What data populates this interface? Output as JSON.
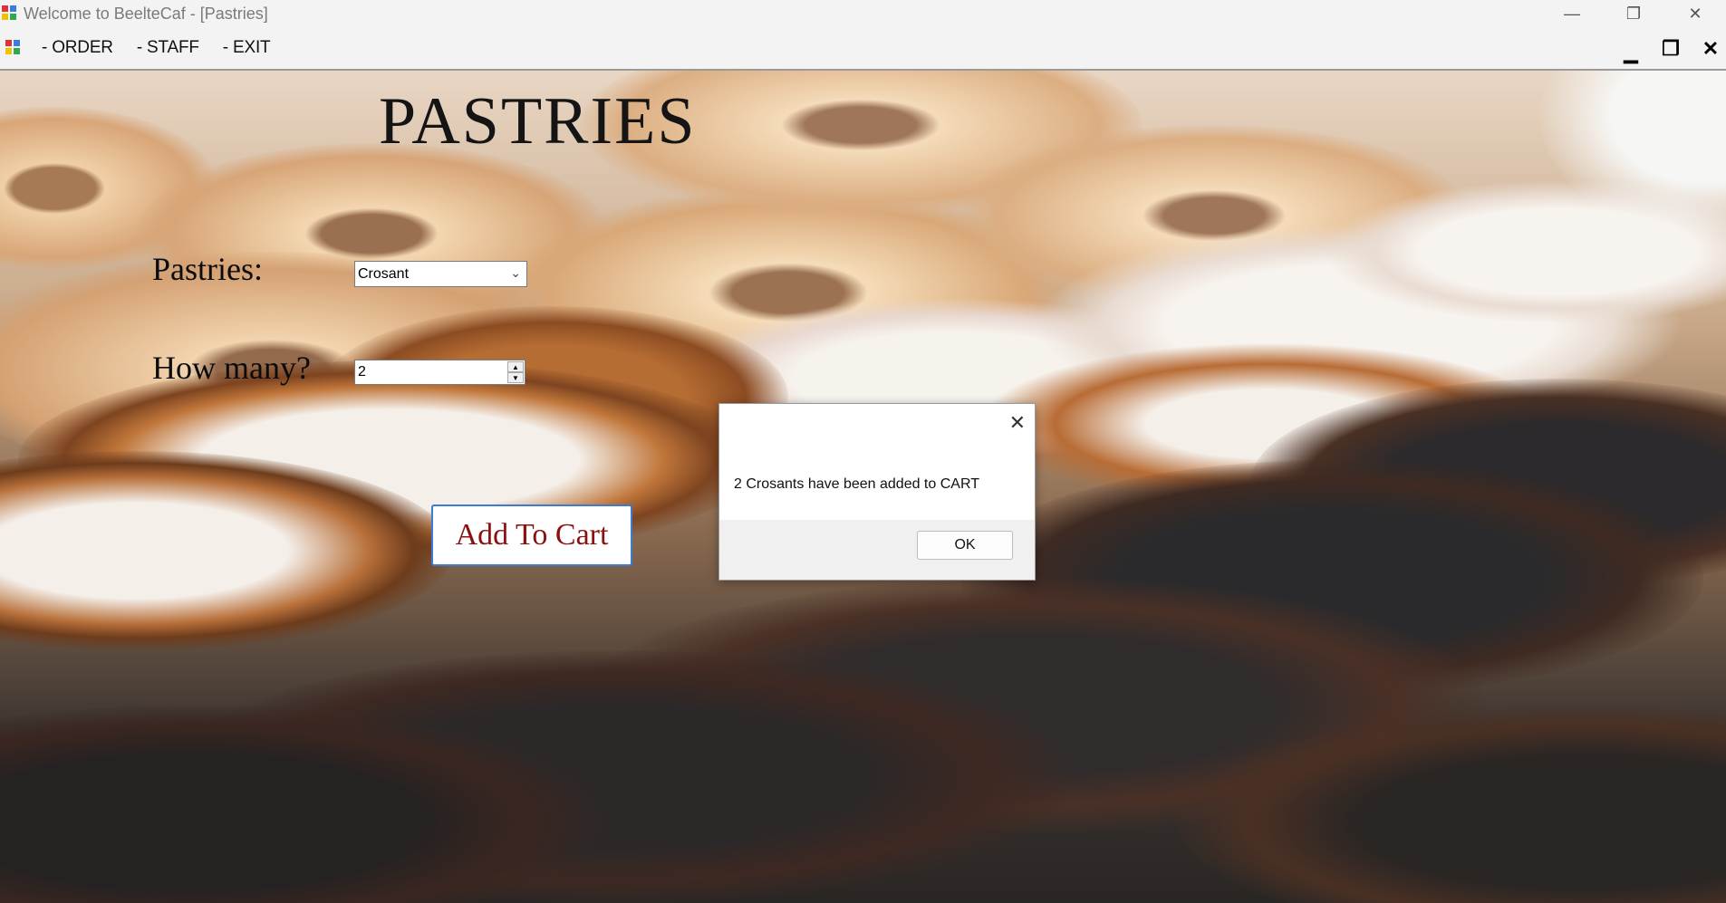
{
  "window": {
    "title": "Welcome to BeelteCaf - [Pastries]",
    "minimize_icon": "minimize-icon",
    "restore_icon": "restore-icon",
    "close_icon": "close-icon"
  },
  "menu": {
    "items": [
      "- ORDER",
      "- STAFF",
      "- EXIT"
    ]
  },
  "form": {
    "heading": "PASTRIES",
    "pastries_label": "Pastries:",
    "pastries_selected": "Crosant",
    "quantity_label": "How many?",
    "quantity_value": "2",
    "add_button": "Add To Cart"
  },
  "dialog": {
    "message": "2 Crosants have been added to CART",
    "ok_label": "OK"
  },
  "colors": {
    "button_text": "#8b1010",
    "button_border": "#3b7bd4"
  }
}
